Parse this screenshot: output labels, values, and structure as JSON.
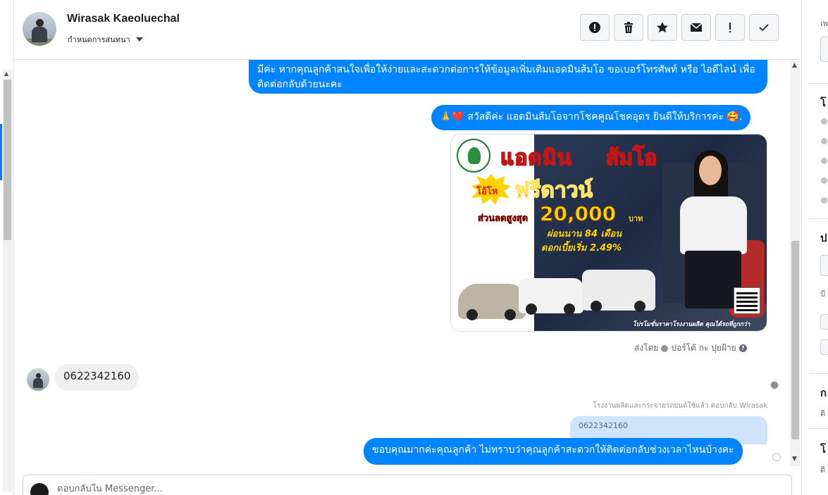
{
  "header": {
    "contact_name": "Wirasak Kaeoluechal",
    "assign_label": "กำหนดการสนทนา"
  },
  "toolbar": {
    "buttons": [
      {
        "icon": "alert-circle-icon"
      },
      {
        "icon": "trash-icon"
      },
      {
        "icon": "star-icon"
      },
      {
        "icon": "envelope-icon"
      },
      {
        "icon": "exclamation-icon"
      },
      {
        "icon": "checkmark-icon"
      }
    ]
  },
  "messages": {
    "m1": "มีค่ะ หากคุณลูกค้าสนใจเพื่อให้ง่ายและสะดวกต่อการให้ข้อมูลเพิ่มเติมแอดมินส้มโอ ขอเบอร์โทรศัพท์ หรือ ไอดีไลน์ เพื่อติดต่อกลับด้วยนะคะ",
    "m2": "🙏❤️ สวัสดีค่ะ แอดมินส้มโอจากโชคคูณโชคอุดร ยินดีให้บริการค่ะ 🥰.",
    "sent_by_prefix": "ส่งโดย",
    "sent_by_name": "ปอร์โต้ กะ ปุยฝ้าย",
    "incoming_phone": "0622342160",
    "reply_note": "โรงงานผลิตและกระจายรถยนต์ใช้แล้ว ตอบกลับ Wirasak",
    "quoted_text": "0622342160",
    "m3": "ขอบคุณมากค่ะคุณลูกค้า ไม่ทราบว่าคุณลูกค้าสะดวกให้ติดต่อกลับช่วงเวลาไหนบ้างคะ"
  },
  "promo": {
    "title_left": "แอดมิน",
    "title_right": "ส้มโอ",
    "burst_text": "โอ้โห",
    "headline": "ฟรีดาวน์",
    "discount_label": "ส่วนลดสูงสุด",
    "amount": "20,000",
    "amount_unit": "บาท",
    "installment": "ผ่อนนาน 84 เดือน",
    "interest": "ดอกเบี้ยเริ่ม 2.49%",
    "footer": "โปรโมชั่นราคาโรงงานผลิต คุณได้รถที่ถูกกว่า"
  },
  "composer": {
    "placeholder": "ตอบกลับใน Messenger..."
  },
  "right_panel": {
    "headings": [
      "โ",
      "ป",
      "ก",
      "โ"
    ],
    "smalls": [
      "เพ",
      "ป้",
      "ติ",
      "ติ"
    ]
  },
  "colors": {
    "outgoing_bubble": "#0084ff",
    "incoming_bubble": "#f1f0f0",
    "quote_bubble": "#cfe3fb"
  }
}
